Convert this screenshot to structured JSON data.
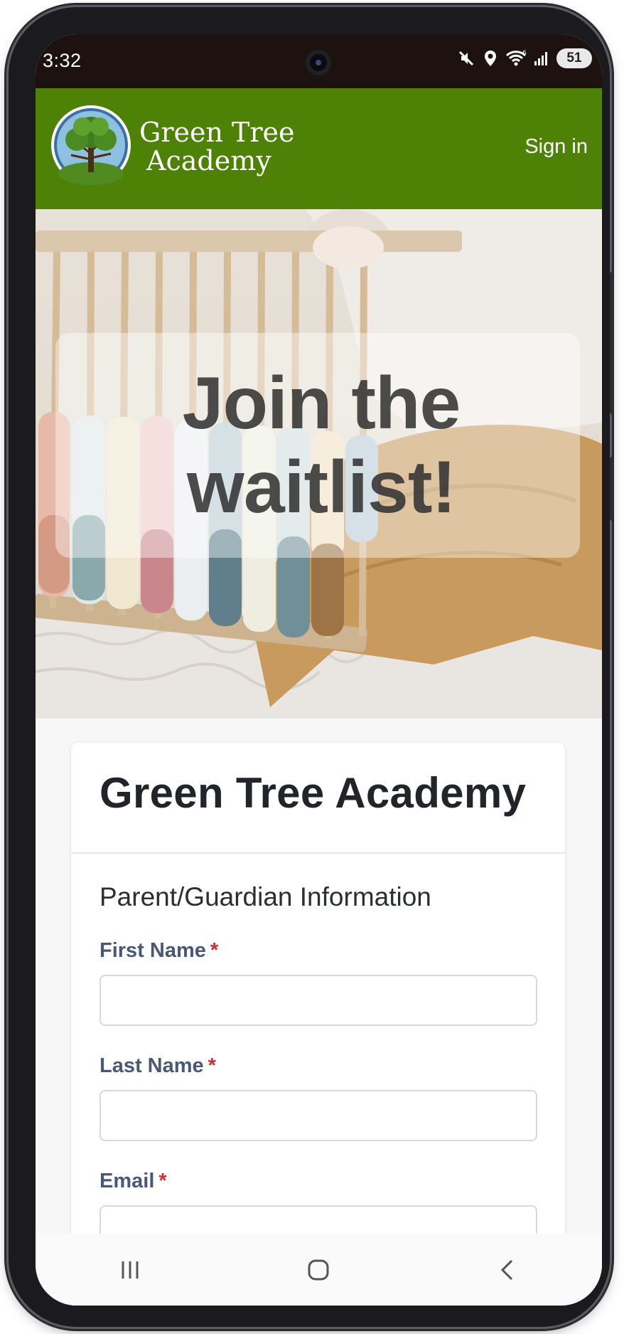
{
  "status_bar": {
    "time": "3:32",
    "battery": "51",
    "icons": [
      "mute-icon",
      "location-icon",
      "wifi-icon",
      "signal-icon"
    ]
  },
  "header": {
    "brand_line1": "Green Tree",
    "brand_line2": "Academy",
    "sign_in": "Sign in",
    "color": "#4d8207"
  },
  "hero": {
    "title": "Join the waitlist!"
  },
  "form": {
    "title": "Green Tree Academy",
    "section": "Parent/Guardian Information",
    "required_marker": "*",
    "fields": [
      {
        "label": "First Name",
        "value": ""
      },
      {
        "label": "Last Name",
        "value": ""
      },
      {
        "label": "Email",
        "value": ""
      }
    ]
  },
  "nav": {
    "icons": [
      "recent-apps-icon",
      "home-icon",
      "back-icon"
    ]
  }
}
